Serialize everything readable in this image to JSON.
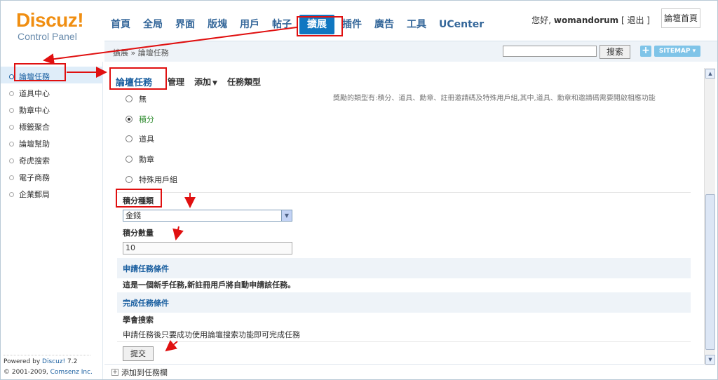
{
  "header": {
    "logo_title": "Discuz!",
    "logo_subtitle": "Control Panel",
    "nav": [
      "首頁",
      "全局",
      "界面",
      "版塊",
      "用戶",
      "帖子",
      "擴展",
      "插件",
      "廣告",
      "工具",
      "UCenter"
    ],
    "active_nav": "擴展",
    "greeting": "您好,",
    "username": "womandorum",
    "logout": "[ 退出 ]",
    "forum_home": "論壇首頁"
  },
  "subbar": {
    "breadcrumb": "擴展 » 論壇任務",
    "search_placeholder": "",
    "search_button": "搜索",
    "plus_button": "+",
    "sitemap_button": "SITEMAP"
  },
  "sidebar": {
    "items": [
      "論壇任務",
      "道具中心",
      "勳章中心",
      "標籤聚合",
      "論壇幫助",
      "奇虎搜索",
      "電子商務",
      "企業郵局"
    ],
    "active_index": 0,
    "powered_by_prefix": "Powered by ",
    "powered_by_brand": "Discuz!",
    "powered_by_version": " 7.2",
    "copyright_prefix": "© 2001-2009, ",
    "copyright_company": "Comsenz Inc."
  },
  "main": {
    "tabs": {
      "title": "論壇任務",
      "manage": "管理",
      "add": "添加",
      "types": "任務類型"
    },
    "reward_options": [
      "無",
      "積分",
      "道具",
      "勳章",
      "特殊用戶組"
    ],
    "reward_selected_index": 1,
    "reward_hint": "獎勵的類型有:積分、道具、勳章、註冊邀請碼及特殊用戶組,其中,道具、勳章和邀請碼需要開啟相應功能",
    "credit_type_label": "積分種類",
    "credit_type_value": "金錢",
    "credit_amount_label": "積分數量",
    "credit_amount_value": "10",
    "apply_condition_title": "申請任務條件",
    "apply_condition_text": "這是一個新手任務,新註冊用戶將自動申請該任務。",
    "complete_condition_title": "完成任務條件",
    "complete_condition_name": "學會搜索",
    "complete_condition_desc": "申請任務後只要成功使用論壇搜索功能即可完成任務",
    "submit_button": "提交"
  },
  "bottombar": {
    "add_to_taskbar": "添加到任務欄"
  },
  "colors": {
    "accent": "#1077c1",
    "annotation": "#e01010",
    "selected_option": "#2e8b2e"
  }
}
